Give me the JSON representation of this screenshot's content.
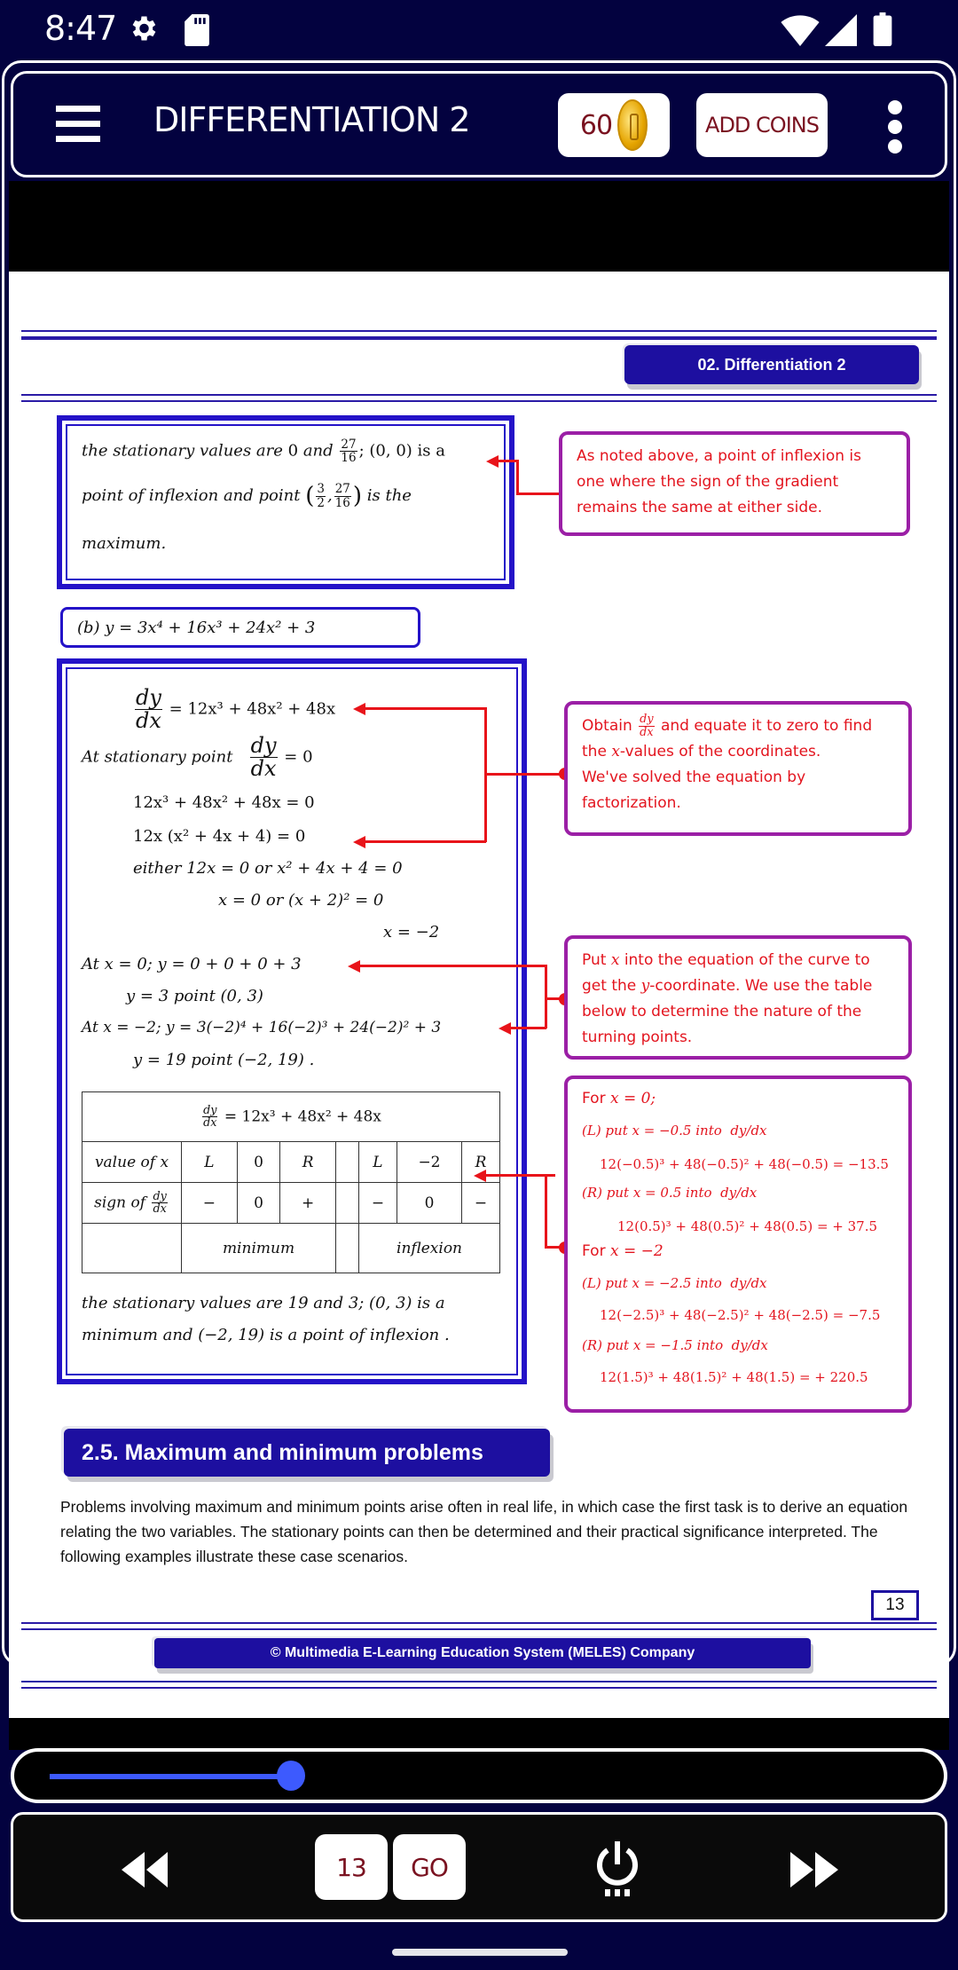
{
  "status_bar": {
    "time": "8:47",
    "icons": [
      "gear-icon",
      "sd-card-icon",
      "wifi-icon",
      "signal-icon",
      "battery-icon"
    ]
  },
  "header": {
    "title": "DIFFERENTIATION 2",
    "coins": "60",
    "add_coins_label": "ADD COINS",
    "menu_icon": "hamburger-icon",
    "more_icon": "more-vert-icon"
  },
  "page": {
    "chapter_tag": "02. Differentiation 2",
    "box1": {
      "line1_a": "the stationary values are",
      "line1_b": "0",
      "line1_c": "and",
      "line1_frac_n": "27",
      "line1_frac_d": "16",
      "line1_d": "; (0, 0) is a",
      "line2_a": "point of inflexion and point",
      "line2_point_x_n": "3",
      "line2_point_x_d": "2",
      "line2_point_y_n": "27",
      "line2_point_y_d": "16",
      "line2_b": "is the",
      "line3": "maximum."
    },
    "note1": "As noted above, a point of inflexion is one where the sign of the gradient remains the same at either side.",
    "equation_b": "(b)  y =  3x⁴ + 16x³ + 24x² + 3",
    "working": {
      "dydx_n": "dy",
      "dydx_d": "dx",
      "l1_rhs": "=  12x³  +  48x² + 48x",
      "l2_lhs": "At stationary point",
      "l2_rhs": "=  0",
      "l3": "12x³  +  48x² + 48x  =  0",
      "l4": "12x (x² + 4x + 4)     =   0",
      "l5": "either  12x  =   0    or    x² + 4x + 4 = 0",
      "l6": "x =  0     or    (x + 2)²   =  0",
      "l7": "x  =  −2",
      "l8": "At  x = 0;  y  =  0 + 0 + 0 + 3",
      "l9": "y  =  3     point  (0,  3)",
      "l10": "At  x = −2;  y = 3(−2)⁴ + 16(−2)³ + 24(−2)² + 3",
      "l11": "y  =   19   point  (−2,  19) ."
    },
    "note2": {
      "part1": "Obtain",
      "frac_n": "dy",
      "frac_d": "dx",
      "part2": "and equate it to zero to find the",
      "var": "x",
      "part3": "-values of the coordinates.",
      "part4": "We've solved the equation by factorization."
    },
    "note3": {
      "part1": "Put",
      "var_x": "x",
      "part2": "into the equation of the curve to get the",
      "var_y": "y",
      "part3": "-coordinate. We use the table below to determine the nature of the turning points."
    },
    "table": {
      "header": "=  12x³  +  48x² +  48x",
      "row1_label": "value of x",
      "row1": [
        "L",
        "0",
        "R",
        "",
        "L",
        "−2",
        "R"
      ],
      "row2_label": "sign of",
      "row2": [
        "−",
        "0",
        "+",
        "",
        "−",
        "0",
        "−"
      ],
      "row3": [
        "",
        "minimum",
        "",
        "inflexion"
      ]
    },
    "conclusion_line1": "the stationary values are  19  and  3;   (0,  3) is a",
    "conclusion_line2": "minimum   and   (−2,  19) is a point of inflexion .",
    "note4": {
      "title1": "For",
      "title1_math": "x = 0;",
      "l1": "(L) put  x = −0.5  into",
      "l1_calc": "12(−0.5)³ + 48(−0.5)² + 48(−0.5) = −13.5",
      "l2": "(R) put  x = 0.5  into",
      "l2_calc": "12(0.5)³ + 48(0.5)² + 48(0.5) = + 37.5",
      "title2": "For",
      "title2_math": "x = −2",
      "l3": "(L) put  x = −2.5  into",
      "l3_calc": "12(−2.5)³ + 48(−2.5)² + 48(−2.5) = −7.5",
      "l4": "(R) put  x = −1.5 into",
      "l4_calc": "12(1.5)³ + 48(1.5)² + 48(1.5) = + 220.5",
      "dydx": "dy/dx"
    },
    "section_heading": "2.5. Maximum and minimum problems",
    "paragraph": "Problems involving maximum and minimum points arise often in real life, in which case the first task is to derive an equation relating the two variables. The stationary points can then be determined and their practical significance interpreted. The following examples illustrate these case scenarios.",
    "page_number": "13",
    "footer": "© Multimedia E-Learning Education System (MELES) Company"
  },
  "controls": {
    "slider_progress": 0.28,
    "page_input_value": "13",
    "go_label": "GO",
    "icons": [
      "rewind-icon",
      "power-icon",
      "fast-forward-icon"
    ]
  }
}
